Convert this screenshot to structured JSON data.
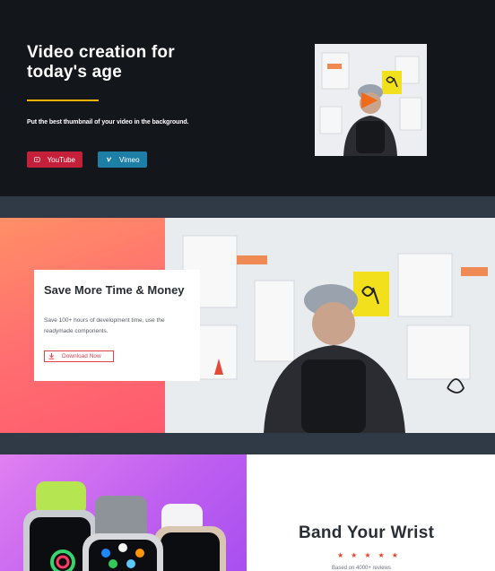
{
  "hero": {
    "title": "Video creation for today's age",
    "subtitle": "Put the best thumbnail of your video in the background.",
    "youtube_label": "YouTube",
    "vimeo_label": "Vimeo",
    "colors": {
      "background": "#13161b",
      "accent_line": "#f4b400",
      "youtube": "#c4203a",
      "vimeo": "#1d7fa6",
      "play": "#f06a1a"
    }
  },
  "promo": {
    "title": "Save More Time & Money",
    "text": "Save 100+ hours of development time, use the readymade components.",
    "download_label": "Download Now",
    "colors": {
      "gradient_start": "#ff8f66",
      "gradient_end": "#ff5a6e",
      "button": "#e0404a"
    }
  },
  "watch": {
    "title": "Band Your Wrist",
    "rating": 5,
    "reviews": "Based on 4000+ reviews",
    "colors": {
      "gradient_start": "#e080f0",
      "gradient_end": "#a84ff0",
      "stars": "#e8452c"
    }
  }
}
